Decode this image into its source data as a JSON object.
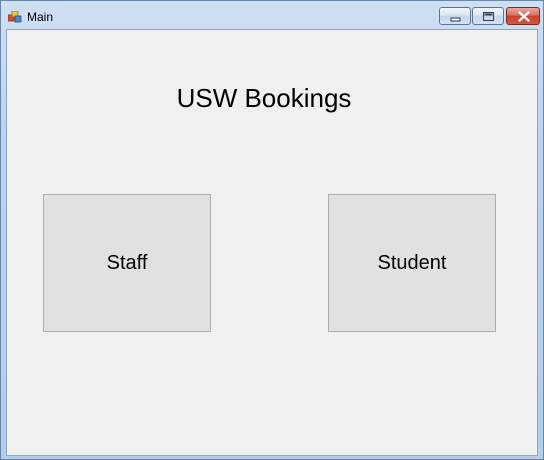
{
  "window": {
    "title": "Main",
    "icon": "winforms-app-icon",
    "controls": {
      "minimize": "minimize-icon",
      "maximize": "maximize-icon",
      "close": "close-icon"
    }
  },
  "main": {
    "heading": "USW Bookings",
    "buttons": {
      "staff_label": "Staff",
      "student_label": "Student"
    }
  },
  "colors": {
    "client_background": "#f0f0f0",
    "button_background": "#e1e1e1",
    "button_border": "#adadad",
    "close_button": "#c7412c"
  }
}
